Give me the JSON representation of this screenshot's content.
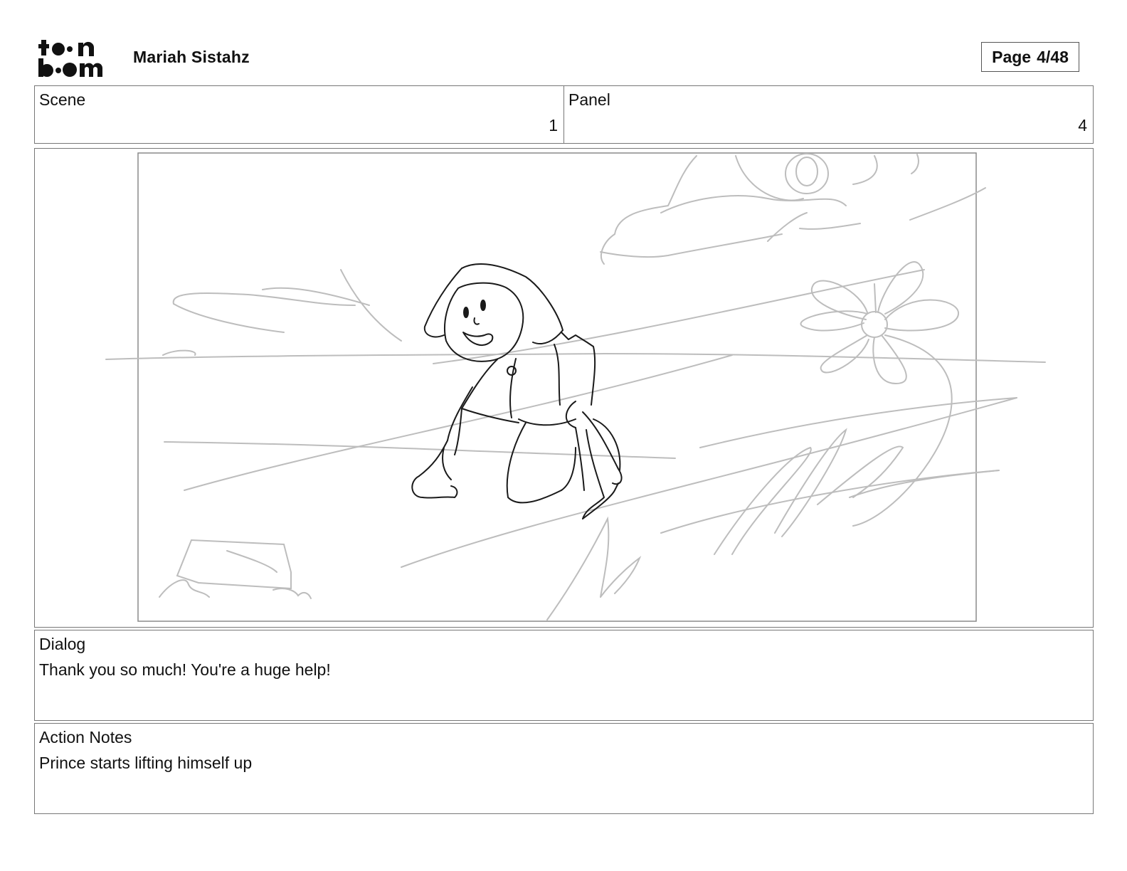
{
  "header": {
    "logo_top": "toon",
    "logo_bottom": "boom",
    "project_title": "Mariah Sistahz",
    "page_label": "Page",
    "page_value": "4/48"
  },
  "info": {
    "scene_label": "Scene",
    "scene_value": "1",
    "panel_label": "Panel",
    "panel_value": "4"
  },
  "panel": {
    "sketch_icon": "storyboard-sketch-kneeling-character-with-flower"
  },
  "dialog": {
    "label": "Dialog",
    "text": "Thank you so much! You're a huge help!"
  },
  "action_notes": {
    "label": "Action Notes",
    "text": "Prince starts lifting himself up"
  },
  "colors": {
    "border": "#777777",
    "sketch_light": "#bdbdbd",
    "sketch_dark": "#1a1a1a"
  }
}
